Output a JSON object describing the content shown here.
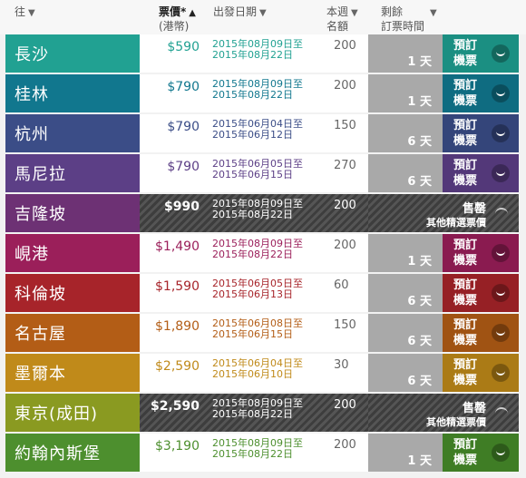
{
  "header": {
    "destination": "往",
    "price": "票價*",
    "price_sub": "(港幣)",
    "period": "出發日期",
    "quota": "本週",
    "quota_sub": "名額",
    "remaining": "剩餘",
    "remaining_sub": "訂票時間",
    "arrow_down": "▼",
    "arrow_up": "▲"
  },
  "book_label_1": "預訂",
  "book_label_2": "機票",
  "sold_label": "售罄",
  "sold_sub": "其他精選票價",
  "rows": [
    {
      "dest": "長沙",
      "price": "$590",
      "date1": "2015年08月09日至",
      "date2": "2015年08月22日",
      "quota": "200",
      "days": "1 天",
      "sold": false,
      "color": "#21a192",
      "book": "#1b8f82"
    },
    {
      "dest": "桂林",
      "price": "$790",
      "date1": "2015年08月09日至",
      "date2": "2015年08月22日",
      "quota": "200",
      "days": "1 天",
      "sold": false,
      "color": "#11778e",
      "book": "#0f6c81"
    },
    {
      "dest": "杭州",
      "price": "$790",
      "date1": "2015年06月04日至",
      "date2": "2015年06月12日",
      "quota": "150",
      "days": "6 天",
      "sold": false,
      "color": "#3b4d87",
      "book": "#34457a"
    },
    {
      "dest": "馬尼拉",
      "price": "$790",
      "date1": "2015年06月05日至",
      "date2": "2015年06月15日",
      "quota": "270",
      "days": "6 天",
      "sold": false,
      "color": "#5c3f86",
      "book": "#533879"
    },
    {
      "dest": "吉隆坡",
      "price": "$990",
      "date1": "2015年08月09日至",
      "date2": "2015年08月22日",
      "quota": "200",
      "days": "",
      "sold": true,
      "color": "#6d3174",
      "book": "#6d3174"
    },
    {
      "dest": "峴港",
      "price": "$1,490",
      "date1": "2015年08月09日至",
      "date2": "2015年08月22日",
      "quota": "200",
      "days": "1 天",
      "sold": false,
      "color": "#9b1f5a",
      "book": "#8a1b50"
    },
    {
      "dest": "科倫坡",
      "price": "$1,590",
      "date1": "2015年06月05日至",
      "date2": "2015年06月13日",
      "quota": "60",
      "days": "6 天",
      "sold": false,
      "color": "#a7242a",
      "book": "#962025"
    },
    {
      "dest": "名古屋",
      "price": "$1,890",
      "date1": "2015年06月08日至",
      "date2": "2015年06月15日",
      "quota": "150",
      "days": "6 天",
      "sold": false,
      "color": "#b35d16",
      "book": "#a05313"
    },
    {
      "dest": "墨爾本",
      "price": "$2,590",
      "date1": "2015年06月04日至",
      "date2": "2015年06月10日",
      "quota": "30",
      "days": "6 天",
      "sold": false,
      "color": "#c08a1a",
      "book": "#ab7b16"
    },
    {
      "dest": "東京(成田)",
      "price": "$2,590",
      "date1": "2015年08月09日至",
      "date2": "2015年08月22日",
      "quota": "200",
      "days": "",
      "sold": true,
      "color": "#8a9a21",
      "book": "#8a9a21"
    },
    {
      "dest": "約翰內斯堡",
      "price": "$3,190",
      "date1": "2015年08月09日至",
      "date2": "2015年08月22日",
      "quota": "200",
      "days": "1 天",
      "sold": false,
      "color": "#4d8f2e",
      "book": "#3f7d25"
    }
  ]
}
